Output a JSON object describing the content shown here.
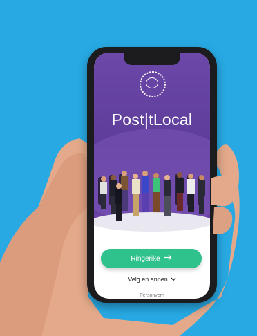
{
  "app": {
    "brand": "Post|tLocal"
  },
  "actions": {
    "primary_label": "Ringerike",
    "secondary_label": "Velg en annen",
    "privacy_label": "Personvern"
  },
  "colors": {
    "background": "#28a9e3",
    "hero": "#6c48a8",
    "primary_button": "#2fc28c"
  },
  "icons": {
    "logo": "chat-bubble-icon",
    "arrow": "arrow-right-icon",
    "chevron": "chevron-down-icon"
  }
}
